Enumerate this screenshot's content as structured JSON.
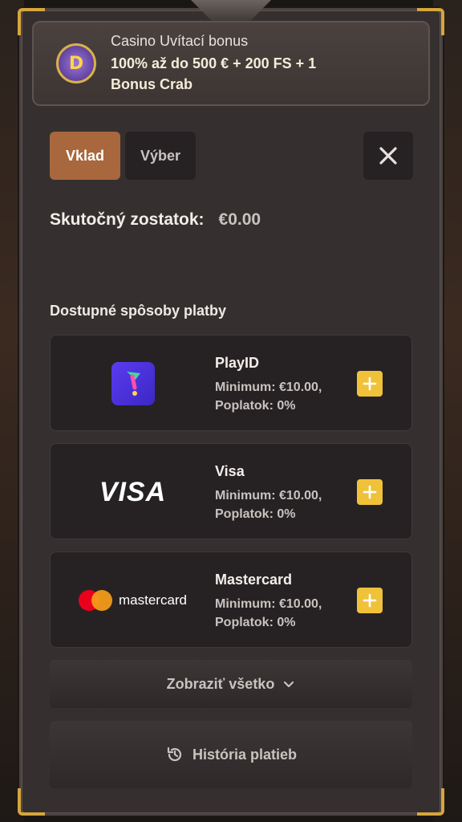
{
  "bonus": {
    "title": "Casino Uvítací bonus",
    "description": "100% až do 500 € + 200 FS + 1 Bonus Crab",
    "logo_letter": "D"
  },
  "tabs": [
    {
      "label": "Vklad",
      "active": true
    },
    {
      "label": "Výber",
      "active": false
    }
  ],
  "close_icon": "close-icon",
  "balance": {
    "label": "Skutočný zostatok:",
    "value": "€0.00"
  },
  "methods_title": "Dostupné spôsoby platby",
  "methods": [
    {
      "name": "PlayID",
      "minimum": "Minimum: €10.00,",
      "fee": "Poplatok: 0%",
      "logo_icon": "playid-logo"
    },
    {
      "name": "Visa",
      "minimum": "Minimum: €10.00,",
      "fee": "Poplatok: 0%",
      "logo_text": "VISA"
    },
    {
      "name": "Mastercard",
      "minimum": "Minimum: €10.00,",
      "fee": "Poplatok: 0%",
      "logo_text": "mastercard"
    }
  ],
  "show_all_label": "Zobraziť všetko",
  "history_label": "História platieb",
  "colors": {
    "accent": "#a8673d",
    "plus": "#f0c23a",
    "gold_corner": "#d6a63c"
  }
}
